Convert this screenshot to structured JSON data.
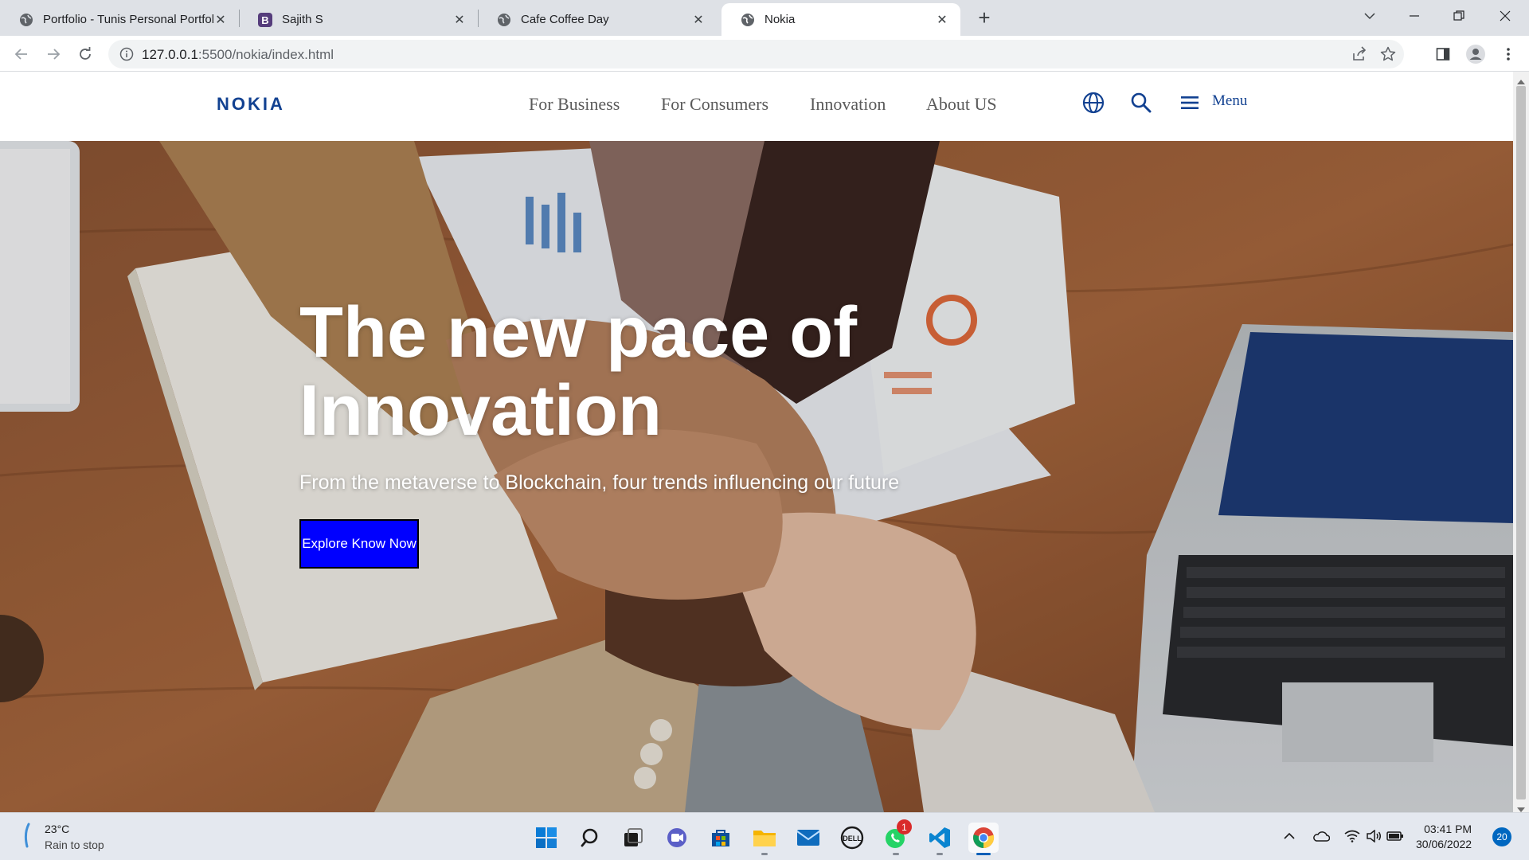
{
  "browser": {
    "tabs": [
      {
        "title": "Portfolio - Tunis Personal Portfolio",
        "favicon": "globe-icon",
        "active": false
      },
      {
        "title": "Sajith S",
        "favicon": "bootstrap-icon",
        "active": false
      },
      {
        "title": "Cafe Coffee Day",
        "favicon": "globe-icon",
        "active": false
      },
      {
        "title": "Nokia",
        "favicon": "globe-icon",
        "active": true
      }
    ],
    "url_host": "127.0.0.1",
    "url_rest": ":5500/nokia/index.html"
  },
  "site": {
    "logo": "NOKIA",
    "nav": [
      "For Business",
      "For Consumers",
      "Innovation",
      "About US"
    ],
    "menu_label": "Menu",
    "brand_color": "#124191"
  },
  "hero": {
    "title_line1": "The new pace of",
    "title_line2": "Innovation",
    "subtitle": "From the metaverse to Blockchain, four trends influencing our future",
    "cta": "Explore Know Now",
    "cta_color": "#0000ff"
  },
  "taskbar": {
    "weather_temp": "23°C",
    "weather_desc": "Rain to stop",
    "whatsapp_badge": "1",
    "time": "03:41 PM",
    "date": "30/06/2022",
    "notifications": "20"
  }
}
